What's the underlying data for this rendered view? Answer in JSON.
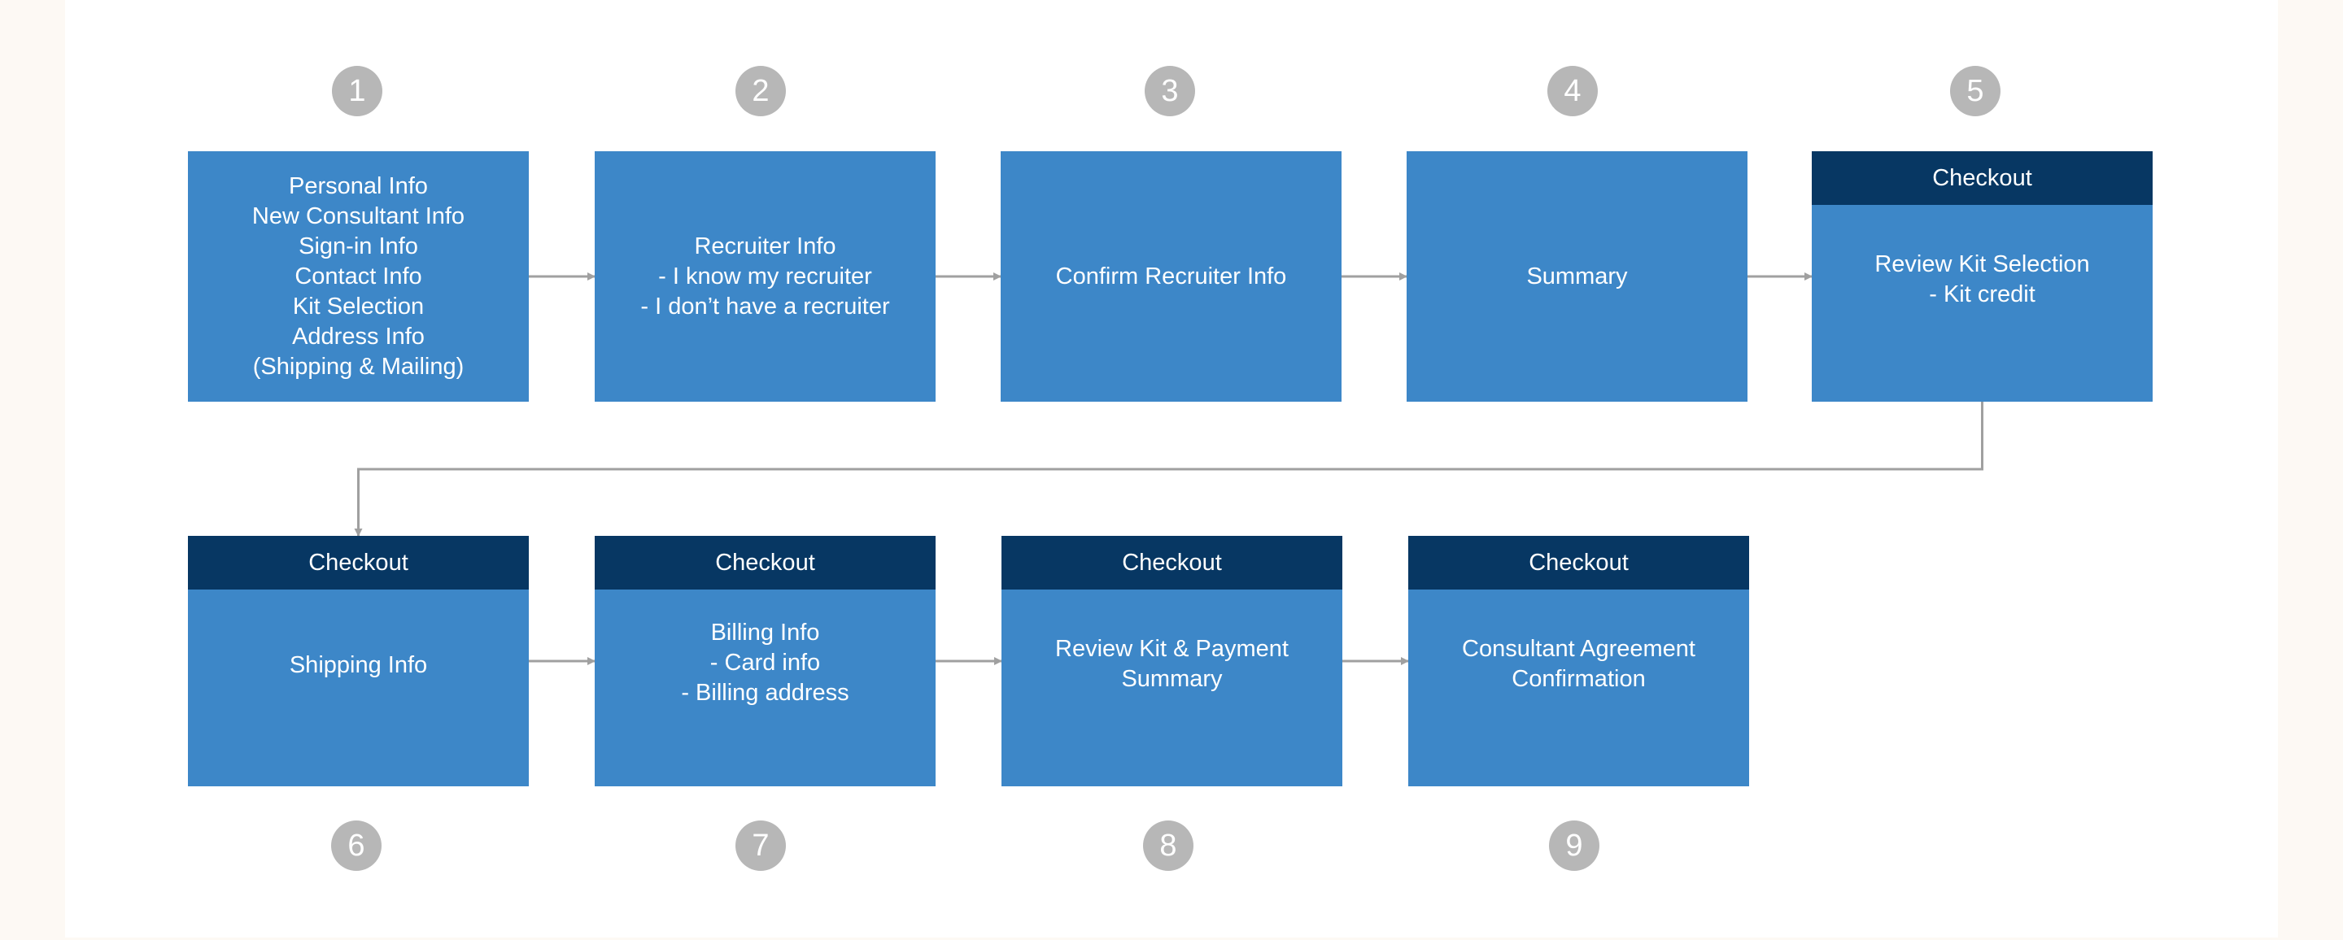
{
  "diagram": {
    "colors": {
      "box": "#3d87c8",
      "header": "#073763",
      "badge": "#b7b7b7",
      "connector": "#a0a0a0",
      "panel": "#ffffff",
      "background": "#fdf9f4"
    },
    "steps": [
      {
        "number": "1",
        "header": null,
        "lines": [
          "Personal Info",
          "New Consultant Info",
          "Sign-in Info",
          "Contact Info",
          "Kit Selection",
          "Address Info",
          "(Shipping & Mailing)"
        ]
      },
      {
        "number": "2",
        "header": null,
        "lines": [
          "Recruiter Info",
          "- I know my recruiter",
          "- I don’t have a recruiter"
        ]
      },
      {
        "number": "3",
        "header": null,
        "lines": [
          "Confirm Recruiter Info"
        ]
      },
      {
        "number": "4",
        "header": null,
        "lines": [
          "Summary"
        ]
      },
      {
        "number": "5",
        "header": "Checkout",
        "lines": [
          "Review Kit Selection",
          "- Kit credit"
        ]
      },
      {
        "number": "6",
        "header": "Checkout",
        "lines": [
          "Shipping Info"
        ]
      },
      {
        "number": "7",
        "header": "Checkout",
        "lines": [
          "Billing Info",
          "- Card info",
          "- Billing address"
        ]
      },
      {
        "number": "8",
        "header": "Checkout",
        "lines": [
          "Review Kit & Payment",
          "Summary"
        ]
      },
      {
        "number": "9",
        "header": "Checkout",
        "lines": [
          "Consultant Agreement",
          "Confirmation"
        ]
      }
    ],
    "edges": [
      [
        "1",
        "2"
      ],
      [
        "2",
        "3"
      ],
      [
        "3",
        "4"
      ],
      [
        "4",
        "5"
      ],
      [
        "5",
        "6"
      ],
      [
        "6",
        "7"
      ],
      [
        "7",
        "8"
      ],
      [
        "8",
        "9"
      ]
    ]
  }
}
